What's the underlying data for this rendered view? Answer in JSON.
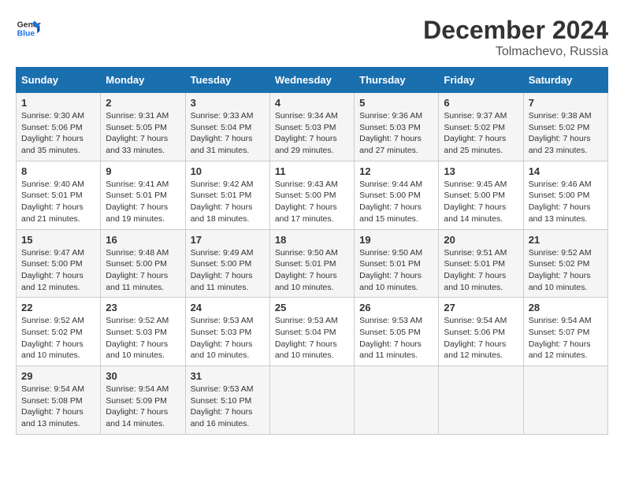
{
  "logo": {
    "line1": "General",
    "line2": "Blue"
  },
  "title": "December 2024",
  "location": "Tolmachevo, Russia",
  "headers": [
    "Sunday",
    "Monday",
    "Tuesday",
    "Wednesday",
    "Thursday",
    "Friday",
    "Saturday"
  ],
  "weeks": [
    [
      {
        "day": "1",
        "sunrise": "Sunrise: 9:30 AM",
        "sunset": "Sunset: 5:06 PM",
        "daylight": "Daylight: 7 hours and 35 minutes."
      },
      {
        "day": "2",
        "sunrise": "Sunrise: 9:31 AM",
        "sunset": "Sunset: 5:05 PM",
        "daylight": "Daylight: 7 hours and 33 minutes."
      },
      {
        "day": "3",
        "sunrise": "Sunrise: 9:33 AM",
        "sunset": "Sunset: 5:04 PM",
        "daylight": "Daylight: 7 hours and 31 minutes."
      },
      {
        "day": "4",
        "sunrise": "Sunrise: 9:34 AM",
        "sunset": "Sunset: 5:03 PM",
        "daylight": "Daylight: 7 hours and 29 minutes."
      },
      {
        "day": "5",
        "sunrise": "Sunrise: 9:36 AM",
        "sunset": "Sunset: 5:03 PM",
        "daylight": "Daylight: 7 hours and 27 minutes."
      },
      {
        "day": "6",
        "sunrise": "Sunrise: 9:37 AM",
        "sunset": "Sunset: 5:02 PM",
        "daylight": "Daylight: 7 hours and 25 minutes."
      },
      {
        "day": "7",
        "sunrise": "Sunrise: 9:38 AM",
        "sunset": "Sunset: 5:02 PM",
        "daylight": "Daylight: 7 hours and 23 minutes."
      }
    ],
    [
      {
        "day": "8",
        "sunrise": "Sunrise: 9:40 AM",
        "sunset": "Sunset: 5:01 PM",
        "daylight": "Daylight: 7 hours and 21 minutes."
      },
      {
        "day": "9",
        "sunrise": "Sunrise: 9:41 AM",
        "sunset": "Sunset: 5:01 PM",
        "daylight": "Daylight: 7 hours and 19 minutes."
      },
      {
        "day": "10",
        "sunrise": "Sunrise: 9:42 AM",
        "sunset": "Sunset: 5:01 PM",
        "daylight": "Daylight: 7 hours and 18 minutes."
      },
      {
        "day": "11",
        "sunrise": "Sunrise: 9:43 AM",
        "sunset": "Sunset: 5:00 PM",
        "daylight": "Daylight: 7 hours and 17 minutes."
      },
      {
        "day": "12",
        "sunrise": "Sunrise: 9:44 AM",
        "sunset": "Sunset: 5:00 PM",
        "daylight": "Daylight: 7 hours and 15 minutes."
      },
      {
        "day": "13",
        "sunrise": "Sunrise: 9:45 AM",
        "sunset": "Sunset: 5:00 PM",
        "daylight": "Daylight: 7 hours and 14 minutes."
      },
      {
        "day": "14",
        "sunrise": "Sunrise: 9:46 AM",
        "sunset": "Sunset: 5:00 PM",
        "daylight": "Daylight: 7 hours and 13 minutes."
      }
    ],
    [
      {
        "day": "15",
        "sunrise": "Sunrise: 9:47 AM",
        "sunset": "Sunset: 5:00 PM",
        "daylight": "Daylight: 7 hours and 12 minutes."
      },
      {
        "day": "16",
        "sunrise": "Sunrise: 9:48 AM",
        "sunset": "Sunset: 5:00 PM",
        "daylight": "Daylight: 7 hours and 11 minutes."
      },
      {
        "day": "17",
        "sunrise": "Sunrise: 9:49 AM",
        "sunset": "Sunset: 5:00 PM",
        "daylight": "Daylight: 7 hours and 11 minutes."
      },
      {
        "day": "18",
        "sunrise": "Sunrise: 9:50 AM",
        "sunset": "Sunset: 5:01 PM",
        "daylight": "Daylight: 7 hours and 10 minutes."
      },
      {
        "day": "19",
        "sunrise": "Sunrise: 9:50 AM",
        "sunset": "Sunset: 5:01 PM",
        "daylight": "Daylight: 7 hours and 10 minutes."
      },
      {
        "day": "20",
        "sunrise": "Sunrise: 9:51 AM",
        "sunset": "Sunset: 5:01 PM",
        "daylight": "Daylight: 7 hours and 10 minutes."
      },
      {
        "day": "21",
        "sunrise": "Sunrise: 9:52 AM",
        "sunset": "Sunset: 5:02 PM",
        "daylight": "Daylight: 7 hours and 10 minutes."
      }
    ],
    [
      {
        "day": "22",
        "sunrise": "Sunrise: 9:52 AM",
        "sunset": "Sunset: 5:02 PM",
        "daylight": "Daylight: 7 hours and 10 minutes."
      },
      {
        "day": "23",
        "sunrise": "Sunrise: 9:52 AM",
        "sunset": "Sunset: 5:03 PM",
        "daylight": "Daylight: 7 hours and 10 minutes."
      },
      {
        "day": "24",
        "sunrise": "Sunrise: 9:53 AM",
        "sunset": "Sunset: 5:03 PM",
        "daylight": "Daylight: 7 hours and 10 minutes."
      },
      {
        "day": "25",
        "sunrise": "Sunrise: 9:53 AM",
        "sunset": "Sunset: 5:04 PM",
        "daylight": "Daylight: 7 hours and 10 minutes."
      },
      {
        "day": "26",
        "sunrise": "Sunrise: 9:53 AM",
        "sunset": "Sunset: 5:05 PM",
        "daylight": "Daylight: 7 hours and 11 minutes."
      },
      {
        "day": "27",
        "sunrise": "Sunrise: 9:54 AM",
        "sunset": "Sunset: 5:06 PM",
        "daylight": "Daylight: 7 hours and 12 minutes."
      },
      {
        "day": "28",
        "sunrise": "Sunrise: 9:54 AM",
        "sunset": "Sunset: 5:07 PM",
        "daylight": "Daylight: 7 hours and 12 minutes."
      }
    ],
    [
      {
        "day": "29",
        "sunrise": "Sunrise: 9:54 AM",
        "sunset": "Sunset: 5:08 PM",
        "daylight": "Daylight: 7 hours and 13 minutes."
      },
      {
        "day": "30",
        "sunrise": "Sunrise: 9:54 AM",
        "sunset": "Sunset: 5:09 PM",
        "daylight": "Daylight: 7 hours and 14 minutes."
      },
      {
        "day": "31",
        "sunrise": "Sunrise: 9:53 AM",
        "sunset": "Sunset: 5:10 PM",
        "daylight": "Daylight: 7 hours and 16 minutes."
      },
      null,
      null,
      null,
      null
    ]
  ]
}
